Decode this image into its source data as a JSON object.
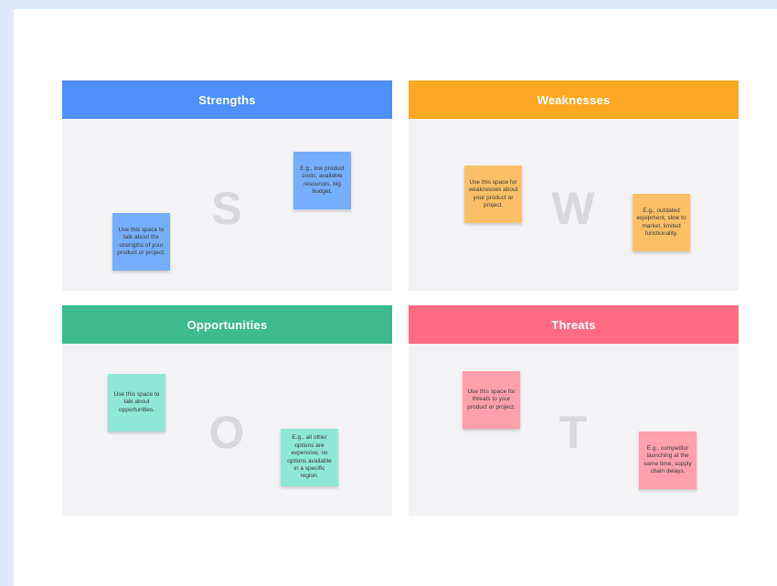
{
  "colors": {
    "strengths": "#4d90f8",
    "weaknesses": "#fba823",
    "opportunities": "#3dbb8e",
    "threats": "#ff6b80",
    "note_blue": "#75aefb",
    "note_orange": "#fcbf68",
    "note_green": "#8ee8d4",
    "note_pink": "#ffa0ad",
    "letter": "#d8d8de"
  },
  "swot": {
    "strengths": {
      "title": "Strengths",
      "letter": "S",
      "notes": [
        "E.g., low product costs, available resources, big budget.",
        "Use this space to talk about the strengths of your product or project."
      ]
    },
    "weaknesses": {
      "title": "Weaknesses",
      "letter": "W",
      "notes": [
        "Use this space for weaknesses about your product or project.",
        "E.g., outdated equipment, slow to market, limited functionality."
      ]
    },
    "opportunities": {
      "title": "Opportunities",
      "letter": "O",
      "notes": [
        "Use this space to talk about opportunities.",
        "E.g., all other options are expensive, no options available in a specific region."
      ]
    },
    "threats": {
      "title": "Threats",
      "letter": "T",
      "notes": [
        "Use this space for threats to your product or project.",
        "E.g., competitor launching at the same time, supply chain delays."
      ]
    }
  }
}
